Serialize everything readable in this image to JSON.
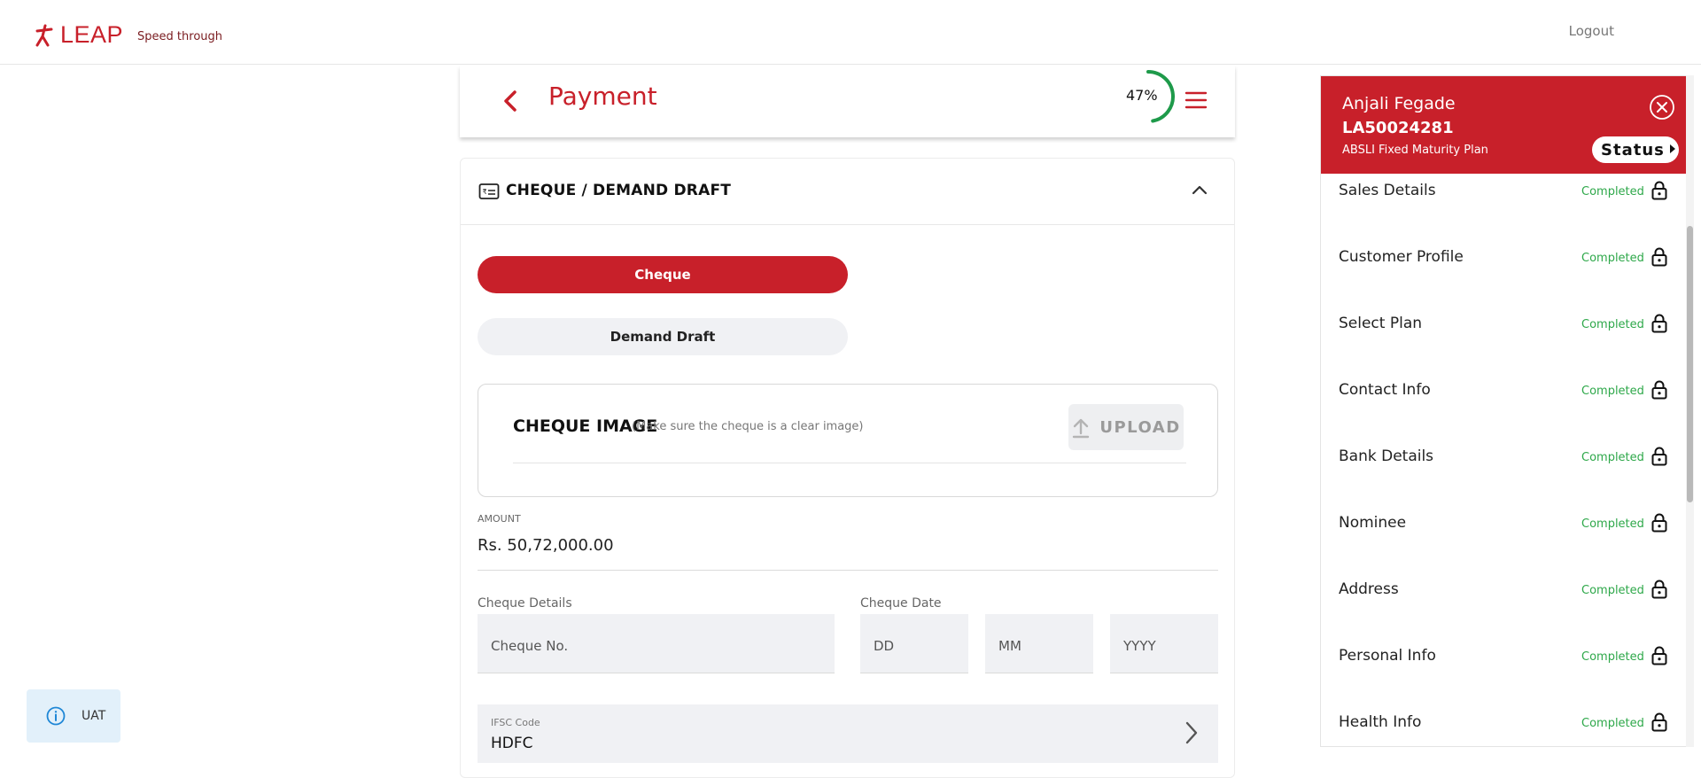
{
  "header": {
    "brand": "LEAP",
    "tagline": "Speed through",
    "logout_label": "Logout"
  },
  "page": {
    "title": "Payment",
    "progress_percent": 47,
    "progress_label": "47%"
  },
  "payment_section": {
    "title": "CHEQUE / DEMAND DRAFT",
    "modes": [
      "Cheque",
      "Demand Draft"
    ],
    "selected_mode": "Cheque",
    "upload": {
      "title": "CHEQUE IMAGE",
      "hint": "(Make sure the cheque is a clear image)",
      "button_label": "UPLOAD"
    },
    "amount": {
      "label": "AMOUNT",
      "value": "Rs. 50,72,000.00"
    },
    "cheque_details": {
      "label": "Cheque Details",
      "placeholder": "Cheque No."
    },
    "cheque_date": {
      "label": "Cheque Date",
      "dd_placeholder": "DD",
      "mm_placeholder": "MM",
      "yyyy_placeholder": "YYYY"
    },
    "ifsc": {
      "label": "IFSC Code",
      "value": "HDFC"
    }
  },
  "env_badge": {
    "label": "UAT"
  },
  "side_panel": {
    "customer_name": "Anjali Fegade",
    "application_id": "LA50024281",
    "plan_name": "ABSLI Fixed Maturity Plan",
    "status_label": "Status",
    "items": [
      {
        "label": "Sales Details",
        "status": "Completed"
      },
      {
        "label": "Customer Profile",
        "status": "Completed"
      },
      {
        "label": "Select Plan",
        "status": "Completed"
      },
      {
        "label": "Contact Info",
        "status": "Completed"
      },
      {
        "label": "Bank Details",
        "status": "Completed"
      },
      {
        "label": "Nominee",
        "status": "Completed"
      },
      {
        "label": "Address",
        "status": "Completed"
      },
      {
        "label": "Personal Info",
        "status": "Completed"
      },
      {
        "label": "Health Info",
        "status": "Completed"
      }
    ]
  },
  "colors": {
    "brand_red": "#c8202a",
    "completed_green": "#2ea84a",
    "progress_green": "#1e9a4a"
  }
}
